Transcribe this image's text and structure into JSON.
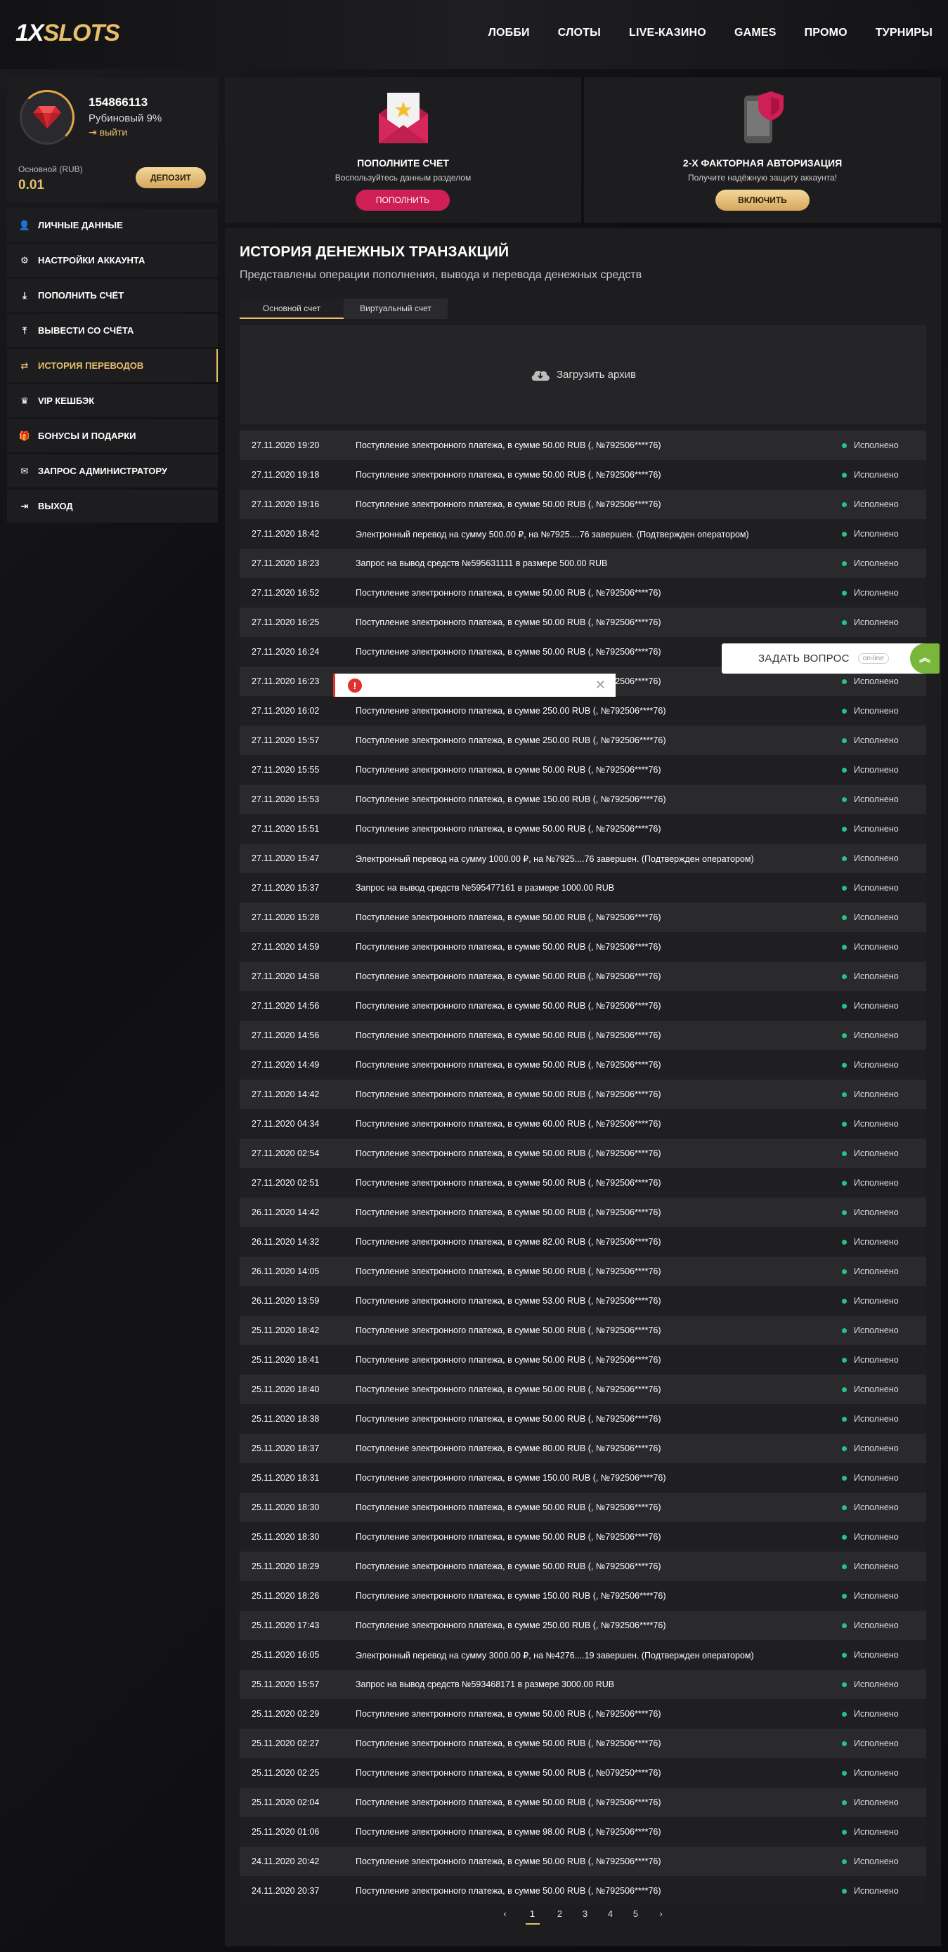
{
  "header": {
    "logo_part1": "1X",
    "logo_part2": "SLOTS",
    "nav": [
      "ЛОББИ",
      "СЛОТЫ",
      "LIVE-КАЗИНО",
      "GAMES",
      "ПРОМО",
      "ТУРНИРЫ"
    ]
  },
  "profile": {
    "user_id": "154866113",
    "rank": "Рубиновый 9%",
    "logout_link": "выйти",
    "balance_label": "Основной (RUB)",
    "balance_value": "0.01",
    "deposit_button": "ДЕПОЗИТ"
  },
  "menu": [
    {
      "label": "ЛИЧНЫЕ ДАННЫЕ",
      "icon": "user-add-icon",
      "glyph": "👤"
    },
    {
      "label": "НАСТРОЙКИ АККАУНТА",
      "icon": "gears-icon",
      "glyph": "⚙"
    },
    {
      "label": "ПОПОЛНИТЬ СЧЁТ",
      "icon": "download-icon",
      "glyph": "⤓"
    },
    {
      "label": "ВЫВЕСТИ СО СЧЁТА",
      "icon": "upload-icon",
      "glyph": "⤒"
    },
    {
      "label": "ИСТОРИЯ ПЕРЕВОДОВ",
      "icon": "transfer-arrows-icon",
      "glyph": "⇄",
      "active": true
    },
    {
      "label": "VIP КЕШБЭК",
      "icon": "crown-icon",
      "glyph": "♛"
    },
    {
      "label": "БОНУСЫ И ПОДАРКИ",
      "icon": "gift-icon",
      "glyph": "🎁"
    },
    {
      "label": "ЗАПРОС АДМИНИСТРАТОРУ",
      "icon": "envelope-icon",
      "glyph": "✉"
    },
    {
      "label": "ВЫХОД",
      "icon": "exit-icon",
      "glyph": "⇥"
    }
  ],
  "cards": {
    "deposit": {
      "title": "ПОПОЛНИТЕ СЧЕТ",
      "subtitle": "Воспользуйтесь данным разделом",
      "button": "ПОПОЛНИТЬ",
      "icon": "envelope-star-icon"
    },
    "twofa": {
      "title": "2-Х ФАКТОРНАЯ АВТОРИЗАЦИЯ",
      "subtitle": "Получите надёжную защиту аккаунта!",
      "button": "ВКЛЮЧИТЬ",
      "icon": "phone-shield-icon"
    }
  },
  "main": {
    "title": "ИСТОРИЯ ДЕНЕЖНЫХ ТРАНЗАКЦИЙ",
    "subtitle": "Представлены операции пополнения, вывода и перевода денежных средств",
    "tabs": [
      "Основной счет",
      "Виртуальный счет"
    ],
    "archive": "Загрузить архив"
  },
  "transactions": [
    {
      "date": "27.11.2020 19:20",
      "desc": "Поступление электронного платежа, в сумме 50.00 RUB (, №792506****76)",
      "status": "Исполнено"
    },
    {
      "date": "27.11.2020 19:18",
      "desc": "Поступление электронного платежа, в сумме 50.00 RUB (, №792506****76)",
      "status": "Исполнено"
    },
    {
      "date": "27.11.2020 19:16",
      "desc": "Поступление электронного платежа, в сумме 50.00 RUB (, №792506****76)",
      "status": "Исполнено"
    },
    {
      "date": "27.11.2020 18:42",
      "desc": "Электронный перевод на сумму 500.00 ₽, на №7925....76 завершен. (Подтвержден оператором)",
      "status": "Исполнено"
    },
    {
      "date": "27.11.2020 18:23",
      "desc": "Запрос на вывод средств №595631111 в размере 500.00 RUB",
      "status": "Исполнено"
    },
    {
      "date": "27.11.2020 16:52",
      "desc": "Поступление электронного платежа, в сумме 50.00 RUB (, №792506****76)",
      "status": "Исполнено"
    },
    {
      "date": "27.11.2020 16:25",
      "desc": "Поступление электронного платежа, в сумме 50.00 RUB (, №792506****76)",
      "status": "Исполнено"
    },
    {
      "date": "27.11.2020 16:24",
      "desc": "Поступление электронного платежа, в сумме 50.00 RUB (, №792506****76)",
      "status": "Исполнено"
    },
    {
      "date": "27.11.2020 16:23",
      "desc": "Поступление электронного платежа, в сумме 50.00 RUB (, №792506****76)",
      "status": "Исполнено"
    },
    {
      "date": "27.11.2020 16:02",
      "desc": "Поступление электронного платежа, в сумме 250.00 RUB (, №792506****76)",
      "status": "Исполнено"
    },
    {
      "date": "27.11.2020 15:57",
      "desc": "Поступление электронного платежа, в сумме 250.00 RUB (, №792506****76)",
      "status": "Исполнено"
    },
    {
      "date": "27.11.2020 15:55",
      "desc": "Поступление электронного платежа, в сумме 50.00 RUB (, №792506****76)",
      "status": "Исполнено"
    },
    {
      "date": "27.11.2020 15:53",
      "desc": "Поступление электронного платежа, в сумме 150.00 RUB (, №792506****76)",
      "status": "Исполнено"
    },
    {
      "date": "27.11.2020 15:51",
      "desc": "Поступление электронного платежа, в сумме 50.00 RUB (, №792506****76)",
      "status": "Исполнено"
    },
    {
      "date": "27.11.2020 15:47",
      "desc": "Электронный перевод на сумму 1000.00 ₽, на №7925....76 завершен. (Подтвержден оператором)",
      "status": "Исполнено"
    },
    {
      "date": "27.11.2020 15:37",
      "desc": "Запрос на вывод средств №595477161 в размере 1000.00 RUB",
      "status": "Исполнено"
    },
    {
      "date": "27.11.2020 15:28",
      "desc": "Поступление электронного платежа, в сумме 50.00 RUB (, №792506****76)",
      "status": "Исполнено"
    },
    {
      "date": "27.11.2020 14:59",
      "desc": "Поступление электронного платежа, в сумме 50.00 RUB (, №792506****76)",
      "status": "Исполнено"
    },
    {
      "date": "27.11.2020 14:58",
      "desc": "Поступление электронного платежа, в сумме 50.00 RUB (, №792506****76)",
      "status": "Исполнено"
    },
    {
      "date": "27.11.2020 14:56",
      "desc": "Поступление электронного платежа, в сумме 50.00 RUB (, №792506****76)",
      "status": "Исполнено"
    },
    {
      "date": "27.11.2020 14:56",
      "desc": "Поступление электронного платежа, в сумме 50.00 RUB (, №792506****76)",
      "status": "Исполнено"
    },
    {
      "date": "27.11.2020 14:49",
      "desc": "Поступление электронного платежа, в сумме 50.00 RUB (, №792506****76)",
      "status": "Исполнено"
    },
    {
      "date": "27.11.2020 14:42",
      "desc": "Поступление электронного платежа, в сумме 50.00 RUB (, №792506****76)",
      "status": "Исполнено"
    },
    {
      "date": "27.11.2020 04:34",
      "desc": "Поступление электронного платежа, в сумме 60.00 RUB (, №792506****76)",
      "status": "Исполнено"
    },
    {
      "date": "27.11.2020 02:54",
      "desc": "Поступление электронного платежа, в сумме 50.00 RUB (, №792506****76)",
      "status": "Исполнено"
    },
    {
      "date": "27.11.2020 02:51",
      "desc": "Поступление электронного платежа, в сумме 50.00 RUB (, №792506****76)",
      "status": "Исполнено"
    },
    {
      "date": "26.11.2020 14:42",
      "desc": "Поступление электронного платежа, в сумме 50.00 RUB (, №792506****76)",
      "status": "Исполнено"
    },
    {
      "date": "26.11.2020 14:32",
      "desc": "Поступление электронного платежа, в сумме 82.00 RUB (, №792506****76)",
      "status": "Исполнено"
    },
    {
      "date": "26.11.2020 14:05",
      "desc": "Поступление электронного платежа, в сумме 50.00 RUB (, №792506****76)",
      "status": "Исполнено"
    },
    {
      "date": "26.11.2020 13:59",
      "desc": "Поступление электронного платежа, в сумме 53.00 RUB (, №792506****76)",
      "status": "Исполнено"
    },
    {
      "date": "25.11.2020 18:42",
      "desc": "Поступление электронного платежа, в сумме 50.00 RUB (, №792506****76)",
      "status": "Исполнено"
    },
    {
      "date": "25.11.2020 18:41",
      "desc": "Поступление электронного платежа, в сумме 50.00 RUB (, №792506****76)",
      "status": "Исполнено"
    },
    {
      "date": "25.11.2020 18:40",
      "desc": "Поступление электронного платежа, в сумме 50.00 RUB (, №792506****76)",
      "status": "Исполнено"
    },
    {
      "date": "25.11.2020 18:38",
      "desc": "Поступление электронного платежа, в сумме 50.00 RUB (, №792506****76)",
      "status": "Исполнено"
    },
    {
      "date": "25.11.2020 18:37",
      "desc": "Поступление электронного платежа, в сумме 80.00 RUB (, №792506****76)",
      "status": "Исполнено"
    },
    {
      "date": "25.11.2020 18:31",
      "desc": "Поступление электронного платежа, в сумме 150.00 RUB (, №792506****76)",
      "status": "Исполнено"
    },
    {
      "date": "25.11.2020 18:30",
      "desc": "Поступление электронного платежа, в сумме 50.00 RUB (, №792506****76)",
      "status": "Исполнено"
    },
    {
      "date": "25.11.2020 18:30",
      "desc": "Поступление электронного платежа, в сумме 50.00 RUB (, №792506****76)",
      "status": "Исполнено"
    },
    {
      "date": "25.11.2020 18:29",
      "desc": "Поступление электронного платежа, в сумме 50.00 RUB (, №792506****76)",
      "status": "Исполнено"
    },
    {
      "date": "25.11.2020 18:26",
      "desc": "Поступление электронного платежа, в сумме 150.00 RUB (, №792506****76)",
      "status": "Исполнено"
    },
    {
      "date": "25.11.2020 17:43",
      "desc": "Поступление электронного платежа, в сумме 250.00 RUB (, №792506****76)",
      "status": "Исполнено"
    },
    {
      "date": "25.11.2020 16:05",
      "desc": "Электронный перевод на сумму 3000.00 ₽, на №4276....19 завершен. (Подтвержден оператором)",
      "status": "Исполнено"
    },
    {
      "date": "25.11.2020 15:57",
      "desc": "Запрос на вывод средств №593468171 в размере 3000.00 RUB",
      "status": "Исполнено"
    },
    {
      "date": "25.11.2020 02:29",
      "desc": "Поступление электронного платежа, в сумме 50.00 RUB (, №792506****76)",
      "status": "Исполнено"
    },
    {
      "date": "25.11.2020 02:27",
      "desc": "Поступление электронного платежа, в сумме 50.00 RUB (, №792506****76)",
      "status": "Исполнено"
    },
    {
      "date": "25.11.2020 02:25",
      "desc": "Поступление электронного платежа, в сумме 50.00 RUB (, №079250****76)",
      "status": "Исполнено"
    },
    {
      "date": "25.11.2020 02:04",
      "desc": "Поступление электронного платежа, в сумме 50.00 RUB (, №792506****76)",
      "status": "Исполнено"
    },
    {
      "date": "25.11.2020 01:06",
      "desc": "Поступление электронного платежа, в сумме 98.00 RUB (, №792506****76)",
      "status": "Исполнено"
    },
    {
      "date": "24.11.2020 20:42",
      "desc": "Поступление электронного платежа, в сумме 50.00 RUB (, №792506****76)",
      "status": "Исполнено"
    },
    {
      "date": "24.11.2020 20:37",
      "desc": "Поступление электронного платежа, в сумме 50.00 RUB (, №792506****76)",
      "status": "Исполнено"
    }
  ],
  "pagination": {
    "prev": "‹",
    "pages": [
      "1",
      "2",
      "3",
      "4",
      "5"
    ],
    "current": "1",
    "next": "›"
  },
  "toast": {
    "icon_glyph": "!",
    "close_glyph": "✕"
  },
  "support": {
    "label": "ЗАДАТЬ ВОПРОС",
    "badge": "on-line",
    "arrow_glyph": "︽"
  },
  "colors": {
    "accent_gold": "#e7bf6b",
    "accent_pink": "#d01e56",
    "status_green": "#22c48a",
    "error_red": "#e0312f",
    "support_green": "#7ab63a"
  }
}
